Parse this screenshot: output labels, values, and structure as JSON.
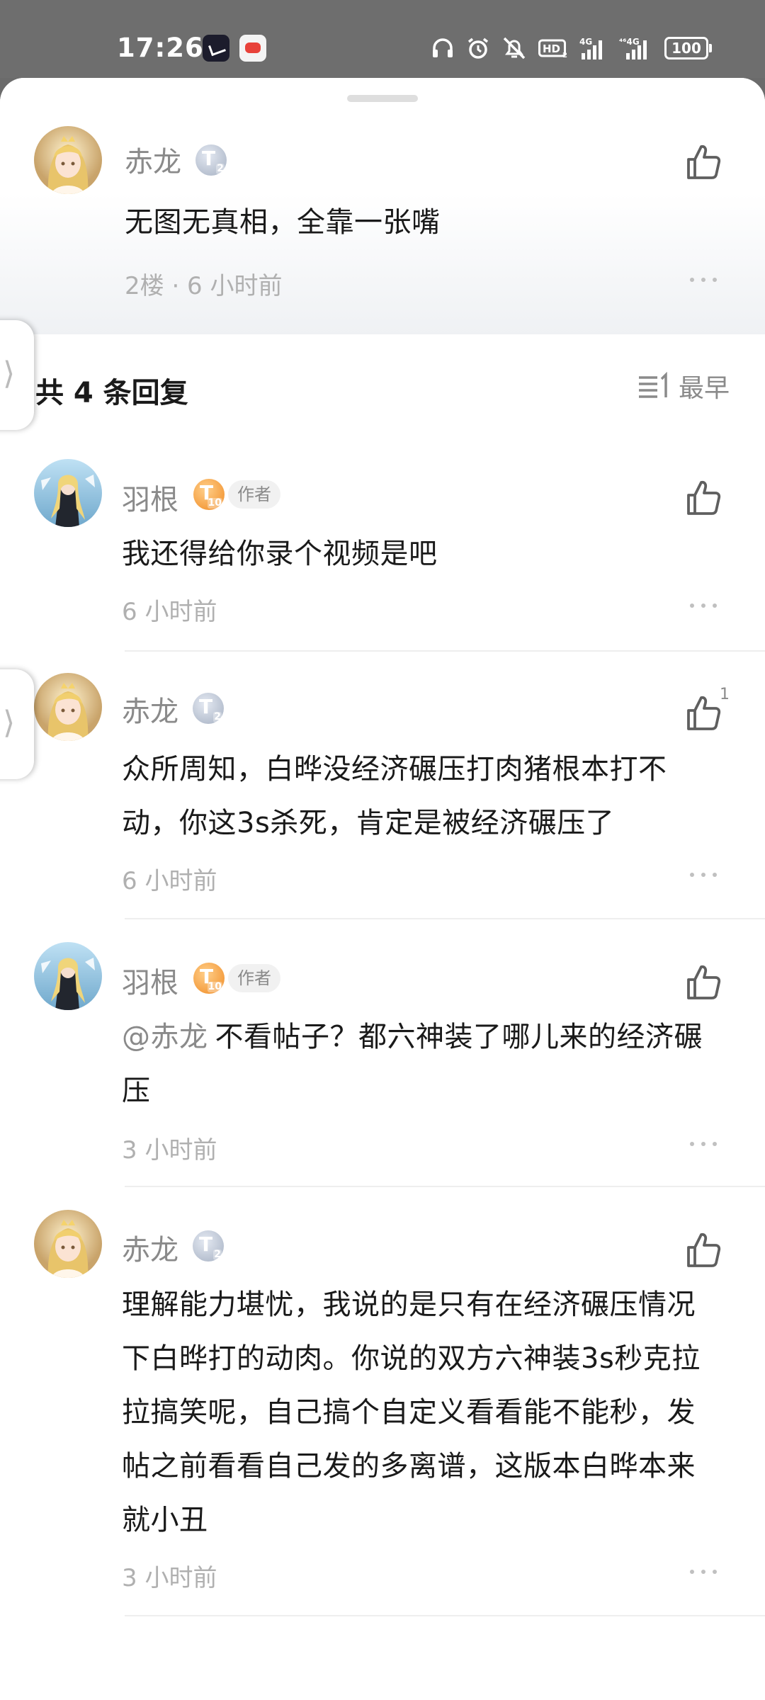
{
  "status_bar": {
    "time": "17:26",
    "battery": "100",
    "icons": [
      "wechat-app-icon",
      "game-app-icon",
      "headphones-icon",
      "alarm-icon",
      "mute-icon",
      "hd-icon",
      "4g-signal-icon",
      "4g-signal-icon-2",
      "battery-icon"
    ]
  },
  "parent_comment": {
    "username": "赤龙",
    "level": "2",
    "content": "无图无真相，全靠一张嘴",
    "meta": "2楼 · 6 小时前"
  },
  "replies_header": {
    "title": "共 4 条回复",
    "sort_label": "最早"
  },
  "replies": [
    {
      "username": "羽根",
      "level": "10",
      "author_tag": "作者",
      "content": "我还得给你录个视频是吧",
      "time": "6 小时前",
      "likes": ""
    },
    {
      "username": "赤龙",
      "level": "2",
      "content_lines": [
        "众所周知，白晔没经济碾压打肉猪根本打不",
        "动，你这3s杀死，肯定是被经济碾压了"
      ],
      "time": "6 小时前",
      "likes": "1"
    },
    {
      "username": "羽根",
      "level": "10",
      "author_tag": "作者",
      "mention": "@赤龙",
      "content_lines": [
        "不看帖子？都六神装了哪儿来的经济碾",
        "压"
      ],
      "time": "3 小时前",
      "likes": ""
    },
    {
      "username": "赤龙",
      "level": "2",
      "content_lines": [
        "理解能力堪忧，我说的是只有在经济碾压情况",
        "下白晔打的动肉。你说的双方六神装3s秒克拉",
        "拉搞笑呢，自己搞个自定义看看能不能秒，发",
        "帖之前看看自己发的多离谱，这版本白晔本来",
        "就小丑"
      ],
      "time": "3 小时前",
      "likes": ""
    }
  ],
  "colors": {
    "accent_gray": "#8a8a8a",
    "meta_gray": "#b0b0b0",
    "author_badge": "#f08a22",
    "level_badge": "#a5b0c2"
  }
}
